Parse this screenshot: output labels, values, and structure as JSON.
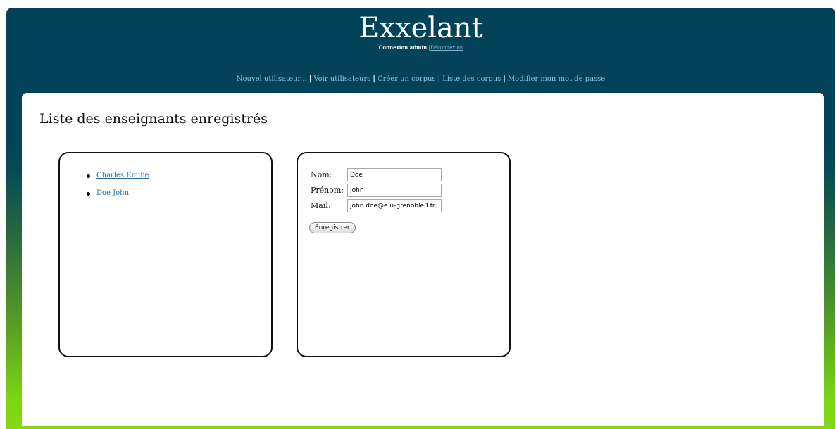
{
  "header": {
    "title": "Exxelant",
    "session_text": "Connexion admin",
    "logout_link": "Déconnexion"
  },
  "nav": {
    "items": [
      "Nouvel utilisateur...",
      "Voir utilisateurs",
      "Créer un corpus",
      "Liste des corpus",
      "Modifier mon mot de passe"
    ],
    "separator": "|"
  },
  "main": {
    "title": "Liste des enseignants enregistrés",
    "users": [
      "Charles Emilie",
      "Doe John"
    ],
    "form": {
      "nom_label": "Nom:",
      "nom_value": "Doe",
      "prenom_label": "Prénom:",
      "prenom_value": "John",
      "mail_label": "Mail:",
      "mail_value": "john.doe@e.u-grenoble3.fr",
      "submit_label": "Enregistrer"
    }
  },
  "colors": {
    "header_bg": "#02435a",
    "gradient_bottom": "#84d811",
    "link": "#2a6aa8"
  }
}
